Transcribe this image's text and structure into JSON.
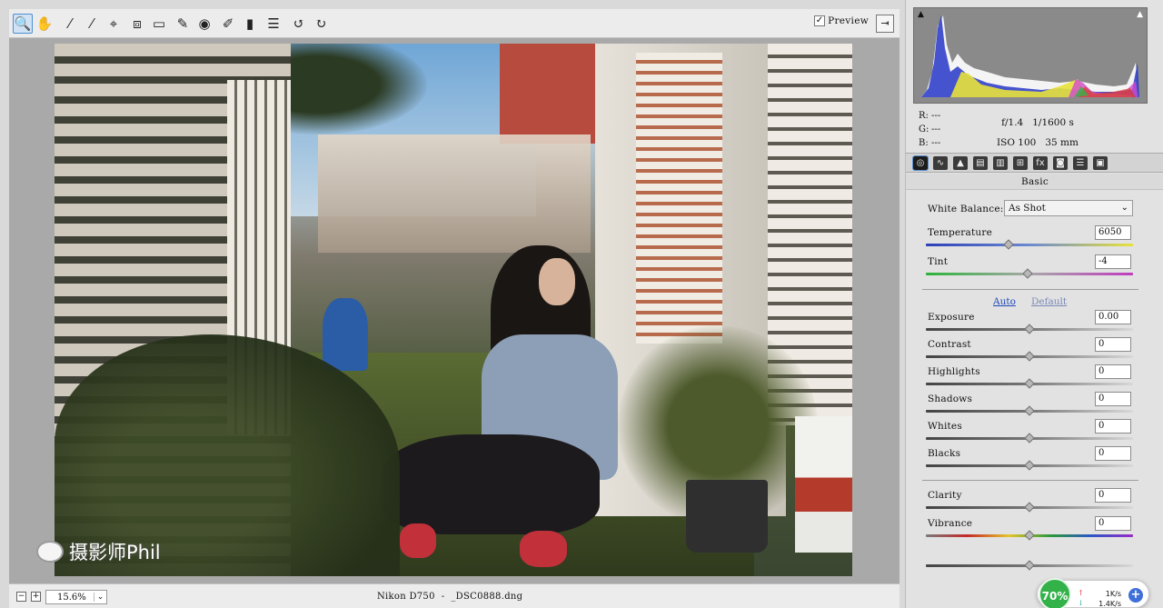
{
  "toolbar": {
    "tools": [
      {
        "name": "zoom-tool",
        "glyph": "🔍"
      },
      {
        "name": "hand-tool",
        "glyph": "✋"
      },
      {
        "name": "white-balance-tool",
        "glyph": "⁄"
      },
      {
        "name": "color-sampler-tool",
        "glyph": "⁄"
      },
      {
        "name": "targeted-adjustment-tool",
        "glyph": "⌖"
      },
      {
        "name": "crop-tool",
        "glyph": "⧈"
      },
      {
        "name": "straighten-tool",
        "glyph": "▭"
      },
      {
        "name": "spot-removal-tool",
        "glyph": "✎"
      },
      {
        "name": "red-eye-tool",
        "glyph": "◉"
      },
      {
        "name": "adjustment-brush-tool",
        "glyph": "✐"
      },
      {
        "name": "graduated-filter-tool",
        "glyph": "▮"
      },
      {
        "name": "preferences-tool",
        "glyph": "☰"
      },
      {
        "name": "rotate-ccw-tool",
        "glyph": "↺"
      },
      {
        "name": "rotate-cw-tool",
        "glyph": "↻"
      }
    ],
    "preview_label": "Preview",
    "preview_checked": true
  },
  "status": {
    "zoom_value": "15.6%",
    "file_info": "Nikon D750  -  _DSC0888.dng"
  },
  "info": {
    "r_label": "R:",
    "g_label": "G:",
    "b_label": "B:",
    "rgb_value": "---",
    "aperture_shutter": "f/1.4   1/1600 s",
    "iso_focal": "ISO 100   35 mm"
  },
  "panel": {
    "section_title": "Basic",
    "white_balance_label": "White Balance:",
    "white_balance_value": "As Shot",
    "auto_label": "Auto",
    "default_label": "Default"
  },
  "sliders": [
    {
      "key": "temperature",
      "label": "Temperature",
      "value": "6050",
      "pos": 0.4,
      "track": "temp"
    },
    {
      "key": "tint",
      "label": "Tint",
      "value": "-4",
      "pos": 0.49,
      "track": "tint"
    },
    {
      "key": "exposure",
      "label": "Exposure",
      "value": "0.00",
      "pos": 0.5,
      "track": "plain"
    },
    {
      "key": "contrast",
      "label": "Contrast",
      "value": "0",
      "pos": 0.5,
      "track": "plain"
    },
    {
      "key": "highlights",
      "label": "Highlights",
      "value": "0",
      "pos": 0.5,
      "track": "plain"
    },
    {
      "key": "shadows",
      "label": "Shadows",
      "value": "0",
      "pos": 0.5,
      "track": "plain"
    },
    {
      "key": "whites",
      "label": "Whites",
      "value": "0",
      "pos": 0.5,
      "track": "plain"
    },
    {
      "key": "blacks",
      "label": "Blacks",
      "value": "0",
      "pos": 0.5,
      "track": "plain"
    },
    {
      "key": "clarity",
      "label": "Clarity",
      "value": "0",
      "pos": 0.5,
      "track": "plain"
    },
    {
      "key": "vibrance",
      "label": "Vibrance",
      "value": "0",
      "pos": 0.5,
      "track": "vib"
    },
    {
      "key": "saturation",
      "label": "",
      "value": "",
      "pos": 0.5,
      "track": "plain"
    }
  ],
  "panel_tabs": [
    "basic",
    "tone-curve",
    "detail",
    "hsl",
    "split-toning",
    "lens-corrections",
    "fx",
    "camera-calibration",
    "presets",
    "snapshots"
  ],
  "watermark": {
    "text": "摄影师Phil"
  },
  "network_widget": {
    "percent": "70%",
    "up": "1K/s",
    "down": "1.4K/s",
    "plus": "+"
  },
  "colors": {
    "accent": "#4d8fd0",
    "link": "#1e47b8",
    "wm_green": "#34b24a"
  }
}
